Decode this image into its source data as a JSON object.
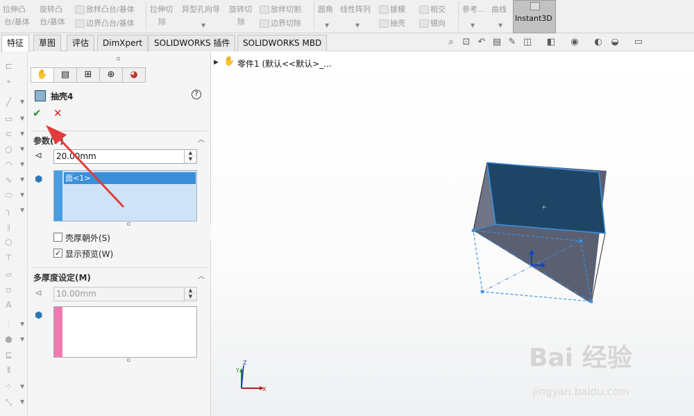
{
  "ribbon": {
    "items": [
      {
        "line1": "拉伸凸",
        "line2": "台/基体"
      },
      {
        "line1": "旋转凸",
        "line2": "台/基体"
      },
      {
        "line1": "放样凸台/基体"
      },
      {
        "line1": "边界凸台/基体"
      },
      {
        "line1": "拉伸切",
        "line2": "除"
      },
      {
        "line1": "异型孔向导"
      },
      {
        "line1": "旋转切",
        "line2": "除"
      },
      {
        "line1": "放样切割"
      },
      {
        "line1": "边界切除"
      },
      {
        "line1": "圆角"
      },
      {
        "line1": "线性阵列"
      },
      {
        "line1": "拔模"
      },
      {
        "line1": "抽壳"
      },
      {
        "line1": "相交"
      },
      {
        "line1": "镜向"
      },
      {
        "line1": "参考..."
      },
      {
        "line1": "曲线"
      }
    ],
    "instant3d": "Instant3D"
  },
  "tabs": [
    "特征",
    "草图",
    "评估",
    "DimXpert",
    "SOLIDWORKS 插件",
    "SOLIDWORKS MBD"
  ],
  "property_manager": {
    "title": "抽壳4",
    "help": "?",
    "ok": "✔",
    "cancel": "✕",
    "params": {
      "header": "参数(P)",
      "thickness_value": "20.00mm",
      "selected_face": "面<1>",
      "shell_outward_label": "壳厚朝外(S)",
      "shell_outward_checked": false,
      "show_preview_label": "显示预览(W)",
      "show_preview_checked": true
    },
    "multi_thickness": {
      "header": "多厚度设定(M)",
      "thickness_value": "10.00mm"
    }
  },
  "graphics": {
    "part_label": "零件1 (默认<<默认>_...",
    "triad": {
      "x": "X",
      "y": "Y",
      "z": "Z"
    }
  },
  "watermark": {
    "brand": "Bai 经验",
    "url": "jingyan.baidu.com"
  },
  "colors": {
    "top_face": "#1f4566",
    "side_face": "#5a6072",
    "edge_highlight": "#3a92e6",
    "annotation_arrow": "#e23b3b"
  }
}
